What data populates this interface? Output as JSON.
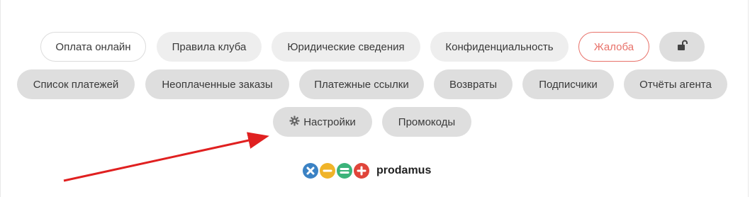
{
  "nav_row1": [
    {
      "label": "Оплата онлайн"
    },
    {
      "label": "Правила клуба"
    },
    {
      "label": "Юридические сведения"
    },
    {
      "label": "Конфиденциальность"
    },
    {
      "label": "Жалоба"
    }
  ],
  "lock_icon": "unlock-icon",
  "nav_row2": [
    {
      "label": "Список платежей"
    },
    {
      "label": "Неоплаченные заказы"
    },
    {
      "label": "Платежные ссылки"
    },
    {
      "label": "Возвраты"
    },
    {
      "label": "Подписчики"
    },
    {
      "label": "Отчёты агента"
    }
  ],
  "nav_row3": [
    {
      "label": "Настройки",
      "icon": "gear-icon"
    },
    {
      "label": "Промокоды"
    }
  ],
  "logo": {
    "name": "prodamus",
    "colors": [
      "#3b82c4",
      "#f0b429",
      "#3bb37a",
      "#e0453a"
    ]
  },
  "annotation": {
    "color": "#e02020"
  }
}
